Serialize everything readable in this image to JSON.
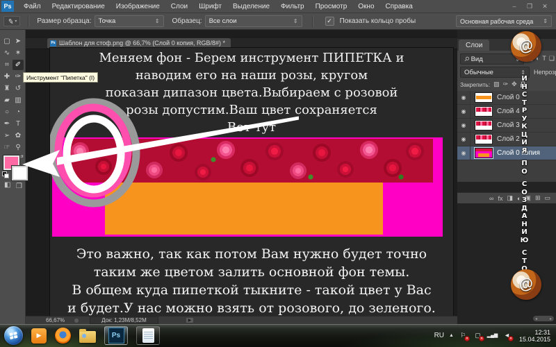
{
  "app": {
    "logo": "Ps",
    "window_buttons": [
      "–",
      "❐",
      "✕"
    ],
    "colors": {
      "magenta": "#ff00c4",
      "orange": "#f7941e",
      "foreground_swatch": "#ff69a4",
      "selected_layer": "#50637a",
      "tooltip_bg": "#fffce1",
      "ui_gray": "#4d4d4d"
    }
  },
  "menu": {
    "items": [
      "Файл",
      "Редактирование",
      "Изображение",
      "Слои",
      "Шрифт",
      "Выделение",
      "Фильтр",
      "Просмотр",
      "Окно",
      "Справка"
    ]
  },
  "options": {
    "sample_size_label": "Размер образца:",
    "sample_size_value": "Точка",
    "sample_label": "Образец:",
    "sample_value": "Все слои",
    "show_ring_label": "Показать кольцо пробы",
    "workspace": "Основная рабочая среда"
  },
  "tools": [
    {
      "name": "rectangular-marquee",
      "glyph": "▢"
    },
    {
      "name": "move",
      "glyph": "➤"
    },
    {
      "name": "lasso",
      "glyph": "∿"
    },
    {
      "name": "magic-wand",
      "glyph": "✶"
    },
    {
      "name": "crop",
      "glyph": "⌗"
    },
    {
      "name": "eyedropper",
      "glyph": "✐",
      "selected": true
    },
    {
      "name": "healing-brush",
      "glyph": "✚"
    },
    {
      "name": "brush",
      "glyph": "✑"
    },
    {
      "name": "clone-stamp",
      "glyph": "♜"
    },
    {
      "name": "history-brush",
      "glyph": "↺"
    },
    {
      "name": "eraser",
      "glyph": "▰"
    },
    {
      "name": "gradient",
      "glyph": "▥"
    },
    {
      "name": "blur",
      "glyph": "○"
    },
    {
      "name": "dodge",
      "glyph": "◔"
    },
    {
      "name": "pen",
      "glyph": "✒"
    },
    {
      "name": "type",
      "glyph": "T"
    },
    {
      "name": "path-selection",
      "glyph": "➢"
    },
    {
      "name": "custom-shape",
      "glyph": "✿"
    },
    {
      "name": "hand",
      "glyph": "☞"
    },
    {
      "name": "zoom",
      "glyph": "⚲"
    }
  ],
  "tooltip": {
    "text": "Инструмент \"Пипетка\" (I)"
  },
  "document": {
    "tab_title": "Шаблон для стоф.png @ 66,7% (Слой 0 копия, RGB/8#) *",
    "status_zoom": "66,67%",
    "status_doc": "Док: 1,23M/8,52M"
  },
  "canvas": {
    "top_lines": [
      "Меняем фон - Берем инструмент ПИПЕТКА и",
      "наводим его на наши розы, кругом",
      "показан дипазон цвета.Выбираем с розовой",
      "розы допустим.Ваш цвет сохраняется",
      "Вот тут"
    ],
    "bottom_lines": [
      "Это важно, так как потом Вам нужно будет точно",
      "таким же цветом залить основной фон темы.",
      "В общем куда пипеткой тыкните - такой цвет у Вас",
      "и будет.У нас можно взять от розового, до зеленого."
    ]
  },
  "layers_panel": {
    "tab": "Слои",
    "filter_value": "Вид",
    "blend_mode": "Обычные",
    "opacity_label": "Непрозр.",
    "lock_label": "Закрепить:",
    "layers": [
      {
        "name": "Слой 0",
        "thumb": "th-orange",
        "selected": false
      },
      {
        "name": "Слой 4",
        "thumb": "th-roses",
        "selected": false
      },
      {
        "name": "Слой 3",
        "thumb": "th-roses",
        "selected": false
      },
      {
        "name": "Слой 2",
        "thumb": "th-roses",
        "selected": false
      },
      {
        "name": "Слой 0 копия",
        "thumb": "th-banner",
        "selected": true
      }
    ]
  },
  "icons": {
    "eye": "◉",
    "search": "⚲",
    "status_arrow": "▶",
    "swap": "⇄",
    "filter_row": [
      {
        "name": "filter-pixel-icon",
        "glyph": "▦"
      },
      {
        "name": "filter-adjustment-icon",
        "glyph": "◐"
      },
      {
        "name": "filter-type-icon",
        "glyph": "T"
      },
      {
        "name": "filter-shape-icon",
        "glyph": "❏"
      }
    ],
    "lock_row": [
      {
        "name": "lock-transparent-icon",
        "glyph": "▨"
      },
      {
        "name": "lock-brush-icon",
        "glyph": "✑"
      },
      {
        "name": "lock-move-icon",
        "glyph": "✥"
      },
      {
        "name": "lock-all-icon",
        "glyph": "padlock"
      }
    ],
    "panel_bottom": [
      {
        "name": "link-layers-icon",
        "glyph": "∞"
      },
      {
        "name": "layer-effects-icon",
        "glyph": "fx"
      },
      {
        "name": "layer-mask-icon",
        "glyph": "◨"
      },
      {
        "name": "adjustment-layer-icon",
        "glyph": "◐"
      },
      {
        "name": "layer-group-icon",
        "glyph": "▣"
      },
      {
        "name": "new-layer-icon",
        "glyph": "⊞"
      },
      {
        "name": "delete-layer-icon",
        "glyph": "▭"
      }
    ]
  },
  "watermark": {
    "text": "ИНСТРУКЦИЯ ПО СОЗДАНИЮ СТОФ",
    "logo_char": "@"
  },
  "taskbar": {
    "apps": [
      {
        "name": "start-button"
      },
      {
        "name": "media-player-icon"
      },
      {
        "name": "firefox-icon"
      },
      {
        "name": "explorer-icon"
      },
      {
        "name": "photoshop-button",
        "active": true
      },
      {
        "name": "notepad-button"
      }
    ],
    "tray": {
      "lang": "RU",
      "icons": [
        {
          "name": "action-center-icon",
          "glyph": "⚐",
          "badge": true
        },
        {
          "name": "network-error-icon",
          "glyph": "▢",
          "badge": true
        },
        {
          "name": "signal-icon",
          "glyph": "▂▄▆",
          "badge": false
        },
        {
          "name": "volume-muted-icon",
          "glyph": "◄",
          "badge": true
        }
      ],
      "time": "12:31",
      "date": "15.04.2015"
    }
  }
}
